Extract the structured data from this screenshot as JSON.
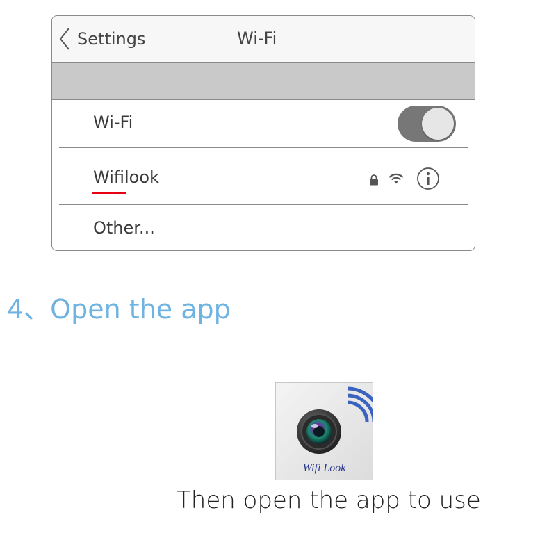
{
  "settings_panel": {
    "back_label": "Settings",
    "title": "Wi-Fi",
    "wifi_row": {
      "label": "Wi-Fi",
      "toggle_on": true
    },
    "network": {
      "name": "Wifilook",
      "secured": true,
      "highlight_color": "#e60012"
    },
    "other_label": "Other..."
  },
  "step": {
    "title": "4、Open the app",
    "color": "#6fb3e3"
  },
  "app": {
    "icon_label": "Wifi Look"
  },
  "caption": "Then open the app to use"
}
